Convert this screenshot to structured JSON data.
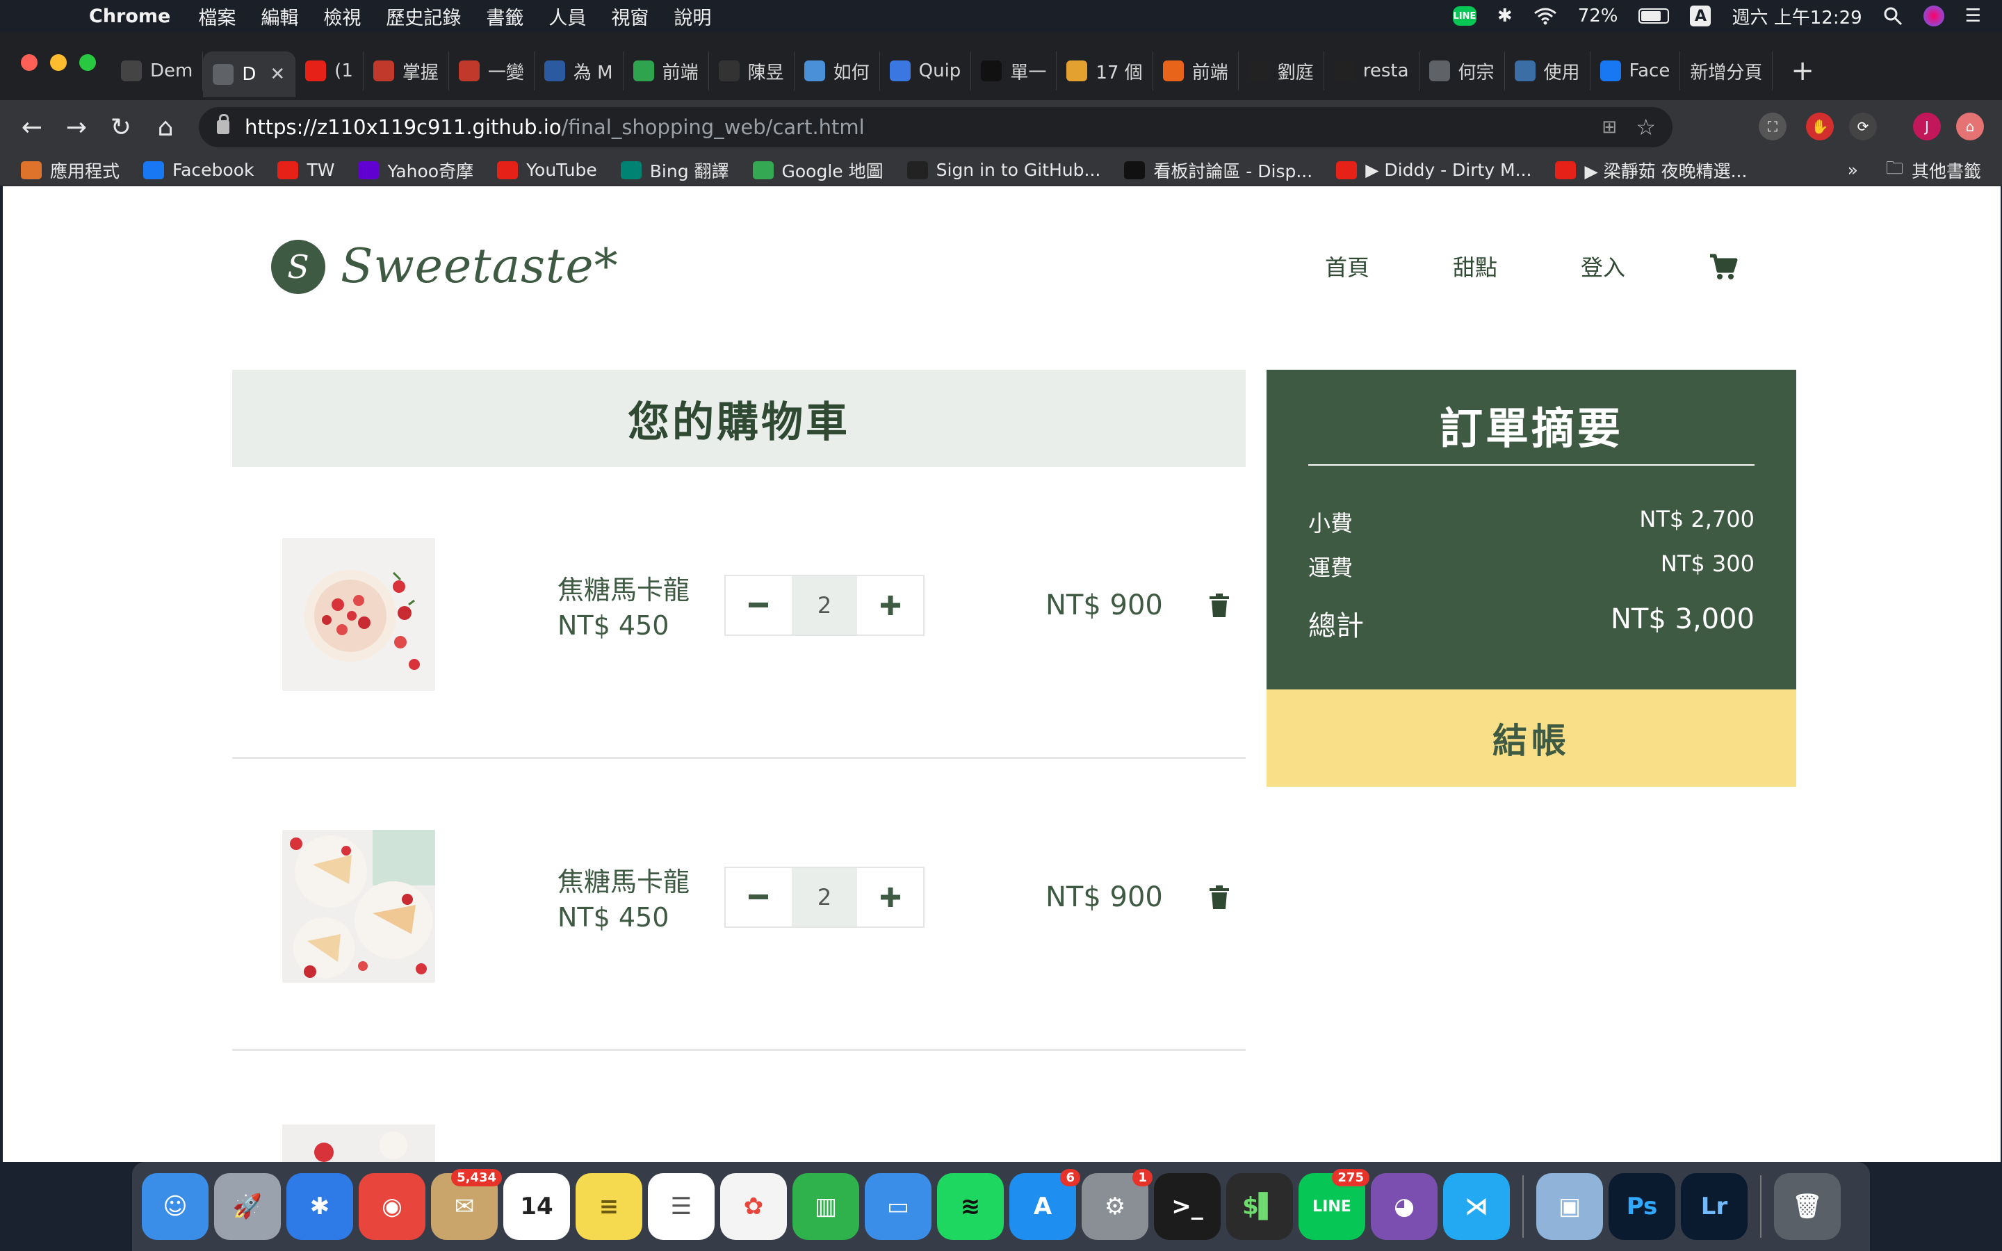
{
  "menubar": {
    "app_name": "Chrome",
    "menus": [
      "檔案",
      "編輯",
      "檢視",
      "歷史記錄",
      "書籤",
      "人員",
      "視窗",
      "說明"
    ],
    "battery": "72%",
    "ime": "A",
    "clock": "週六 上午12:29",
    "line_label": "LINE"
  },
  "browser": {
    "tabs": [
      {
        "label": "Dem",
        "icon": "codepen-icon",
        "color": "#444444"
      },
      {
        "label": "D",
        "icon": "globe-icon",
        "color": "#5f6368",
        "active": true
      },
      {
        "label": "(1",
        "icon": "youtube-icon",
        "color": "#e62117"
      },
      {
        "label": "掌握",
        "icon": "hahow-icon",
        "color": "#c0392b"
      },
      {
        "label": "一變",
        "icon": "hahow-icon",
        "color": "#c0392b"
      },
      {
        "label": "為 M",
        "icon": "pj-icon",
        "color": "#2c5aa0"
      },
      {
        "label": "前端",
        "icon": "c-icon",
        "color": "#2ea44f"
      },
      {
        "label": "陳昱",
        "icon": "bear-icon",
        "color": "#333333"
      },
      {
        "label": "如何",
        "icon": "map-icon",
        "color": "#4a90d9"
      },
      {
        "label": "Quip",
        "icon": "quip-icon",
        "color": "#3b77e0"
      },
      {
        "label": "單一",
        "icon": "medium-icon",
        "color": "#111111"
      },
      {
        "label": "17 個",
        "icon": "w-icon",
        "color": "#e3a12f"
      },
      {
        "label": "前端",
        "icon": "ithome-icon",
        "color": "#e8641b"
      },
      {
        "label": "劉庭",
        "icon": "podcast-icon",
        "color": "#222222"
      },
      {
        "label": "resta",
        "icon": "github-icon",
        "color": "#222222"
      },
      {
        "label": "何宗",
        "icon": "globe-icon",
        "color": "#5f6368"
      },
      {
        "label": "使用",
        "icon": "maze-icon",
        "color": "#3a6ea5"
      },
      {
        "label": "Face",
        "icon": "facebook-icon",
        "color": "#1877f2"
      },
      {
        "label": "新增分頁",
        "icon": "",
        "color": ""
      }
    ],
    "url_host": "https://z110x119c911.github.io",
    "url_path": "/final_shopping_web/cart.html",
    "profile_initial": "J",
    "bookmarks": [
      {
        "label": "應用程式",
        "icon": "apps-grid-icon",
        "color": "#e0732c"
      },
      {
        "label": "Facebook",
        "icon": "facebook-icon",
        "color": "#1877f2"
      },
      {
        "label": "TW",
        "icon": "youtube-icon",
        "color": "#e62117"
      },
      {
        "label": "Yahoo奇摩",
        "icon": "yahoo-icon",
        "color": "#6001d2"
      },
      {
        "label": "YouTube",
        "icon": "youtube-icon",
        "color": "#e62117"
      },
      {
        "label": "Bing 翻譯",
        "icon": "bing-icon",
        "color": "#008373"
      },
      {
        "label": "Google 地圖",
        "icon": "maps-icon",
        "color": "#34a853"
      },
      {
        "label": "Sign in to GitHub...",
        "icon": "github-icon",
        "color": "#222222"
      },
      {
        "label": "看板討論區 - Disp...",
        "icon": "dcard-icon",
        "color": "#111111"
      },
      {
        "label": "▶ Diddy - Dirty M...",
        "icon": "youtube-icon",
        "color": "#e62117"
      },
      {
        "label": "▶ 梁靜茹 夜晚精選...",
        "icon": "youtube-icon",
        "color": "#e62117"
      }
    ],
    "bookmarks_more": "»",
    "other_bookmarks": "其他書籤"
  },
  "site": {
    "logo_letter": "S",
    "logo_text": "Sweetaste*",
    "nav": [
      "首頁",
      "甜點",
      "登入"
    ],
    "accent": "#3f5a43",
    "cart_title": "您的購物車",
    "items": [
      {
        "name": "焦糖馬卡龍",
        "unit_price": "NT$ 450",
        "quantity": "2",
        "total": "NT$ 900",
        "image": "strawberry-cake-photo"
      },
      {
        "name": "焦糖馬卡龍",
        "unit_price": "NT$ 450",
        "quantity": "2",
        "total": "NT$ 900",
        "image": "cake-slices-photo"
      }
    ],
    "summary": {
      "title": "訂單摘要",
      "subtotal_label": "小費",
      "subtotal_value": "NT$ 2,700",
      "shipping_label": "運費",
      "shipping_value": "NT$ 300",
      "total_label": "總計",
      "total_value": "NT$ 3,000"
    },
    "checkout_label": "結帳"
  },
  "dock": {
    "apps": [
      {
        "name": "finder",
        "color": "#3b8ee8",
        "glyph": "☺"
      },
      {
        "name": "launchpad",
        "color": "#9aa3ad",
        "glyph": "🚀"
      },
      {
        "name": "safari",
        "color": "#2e7be8",
        "glyph": "✱"
      },
      {
        "name": "chrome",
        "color": "#e8453c",
        "glyph": "◉"
      },
      {
        "name": "mail",
        "color": "#c9a46b",
        "glyph": "✉",
        "badge": "5,434"
      },
      {
        "name": "calendar",
        "color": "#ffffff",
        "glyph": "14",
        "text_color": "#222"
      },
      {
        "name": "notes",
        "color": "#f5d94e",
        "glyph": "≡",
        "text_color": "#6b5a10"
      },
      {
        "name": "reminders",
        "color": "#ffffff",
        "glyph": "☰",
        "text_color": "#555"
      },
      {
        "name": "photos",
        "color": "#f4f4f4",
        "glyph": "✿",
        "text_color": "#e8453c"
      },
      {
        "name": "numbers",
        "color": "#2fb14b",
        "glyph": "▥"
      },
      {
        "name": "keynote",
        "color": "#3b8ee8",
        "glyph": "▭"
      },
      {
        "name": "spotify",
        "color": "#1ed760",
        "glyph": "≋",
        "text_color": "#111"
      },
      {
        "name": "app-store",
        "color": "#1f8ef1",
        "glyph": "A",
        "badge": "6"
      },
      {
        "name": "system-preferences",
        "color": "#8a8f96",
        "glyph": "⚙",
        "badge": "1"
      },
      {
        "name": "terminal",
        "color": "#1c1c1c",
        "glyph": ">_"
      },
      {
        "name": "iterm",
        "color": "#2b2b2b",
        "glyph": "$▌",
        "text_color": "#6fdc6f"
      },
      {
        "name": "line",
        "color": "#06c755",
        "glyph": "LINE",
        "badge": "275"
      },
      {
        "name": "github-desktop",
        "color": "#7b4fb0",
        "glyph": "◕"
      },
      {
        "name": "vscode",
        "color": "#23a9f2",
        "glyph": "⋊"
      },
      {
        "name": "preview",
        "color": "#8fb3d9",
        "glyph": "▣"
      },
      {
        "name": "photoshop",
        "color": "#0a1b2f",
        "glyph": "Ps",
        "text_color": "#31a8ff"
      },
      {
        "name": "lightroom",
        "color": "#0a1b2f",
        "glyph": "Lr",
        "text_color": "#73b9ff"
      },
      {
        "name": "trash",
        "color": "#5a6068",
        "glyph": "🗑"
      }
    ]
  }
}
